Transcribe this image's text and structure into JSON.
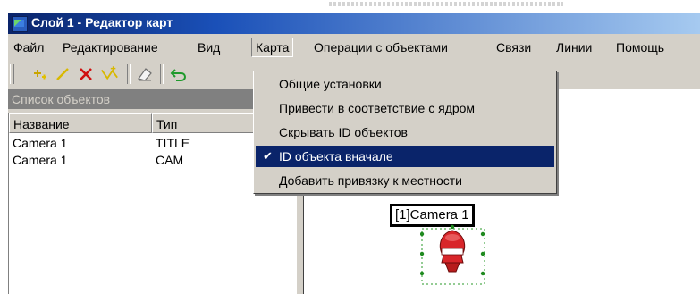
{
  "window": {
    "title": "Слой 1 - Редактор карт"
  },
  "menu": {
    "items": [
      {
        "label": "Файл"
      },
      {
        "label": "Редактирование"
      },
      {
        "label": "Вид"
      },
      {
        "label": "Карта"
      },
      {
        "label": "Операции с объектами"
      },
      {
        "label": "Связи"
      },
      {
        "label": "Линии"
      },
      {
        "label": "Помощь"
      }
    ],
    "open_item": "Карта"
  },
  "toolbar": {
    "buttons": [
      {
        "icon": "add-object-icon"
      },
      {
        "icon": "draw-line-icon"
      },
      {
        "icon": "delete-icon"
      },
      {
        "icon": "link-nodes-icon"
      },
      {
        "icon": "eraser-icon"
      },
      {
        "icon": "undo-icon"
      }
    ]
  },
  "object_list": {
    "title": "Список объектов",
    "columns": [
      "Название",
      "Тип"
    ],
    "rows": [
      {
        "name": "Camera 1",
        "type": "TITLE"
      },
      {
        "name": "Camera 1",
        "type": "CAM"
      }
    ]
  },
  "dropdown": {
    "items": [
      {
        "label": "Общие установки",
        "checked": false,
        "selected": false
      },
      {
        "label": "Привести в соответствие с ядром",
        "checked": false,
        "selected": false
      },
      {
        "label": "Скрывать ID объектов",
        "checked": false,
        "selected": false
      },
      {
        "label": "ID объекта вначале",
        "checked": true,
        "selected": true
      },
      {
        "label": "Добавить привязку к местности",
        "checked": false,
        "selected": false
      }
    ],
    "check_glyph": "✔"
  },
  "map": {
    "label": "[1]Camera 1",
    "object_icon": "camera-icon"
  },
  "colors": {
    "titlebar_start": "#0a246a",
    "titlebar_end": "#a6caf0",
    "highlight": "#0a246a",
    "face": "#d4d0c8",
    "camera_red": "#d8262a"
  }
}
